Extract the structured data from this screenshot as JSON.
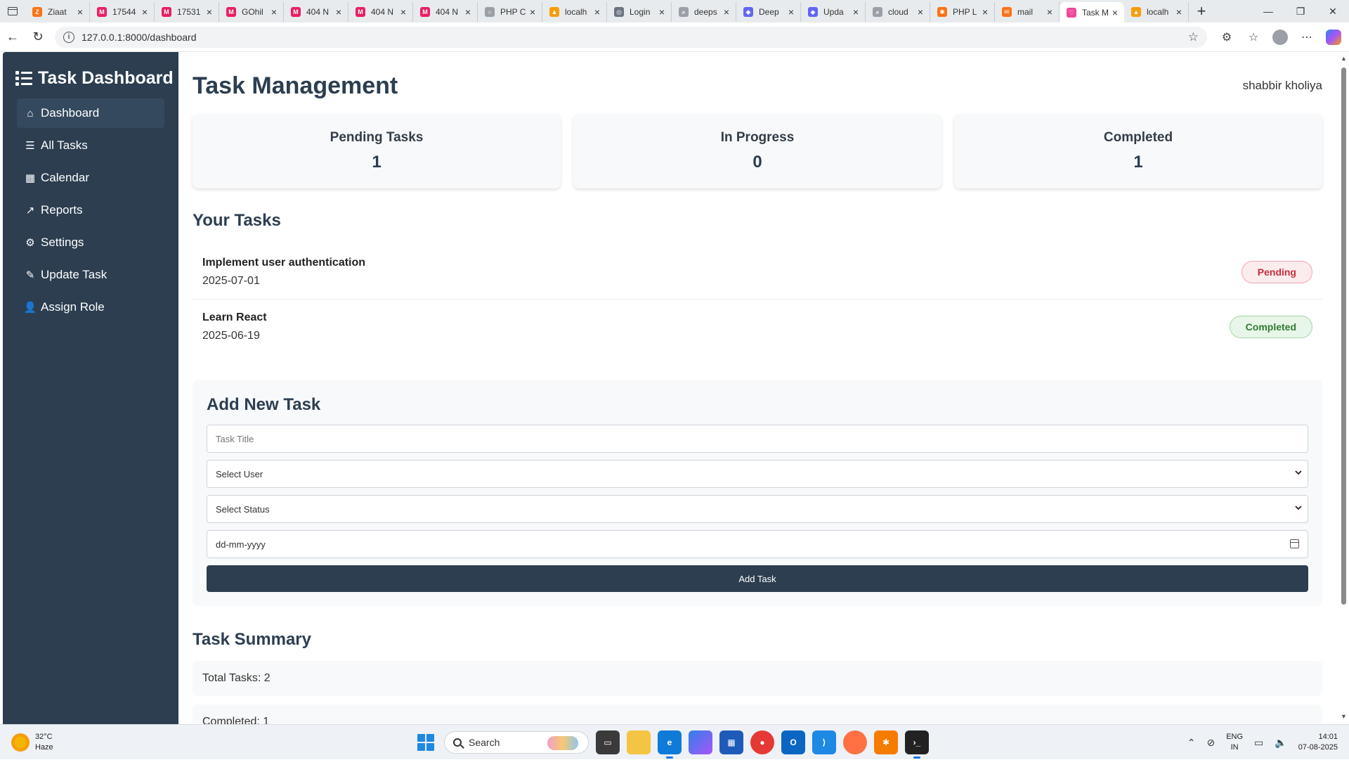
{
  "browser": {
    "tabs": [
      {
        "title": "Ziaat",
        "color": "#f97316",
        "glyph": "Z"
      },
      {
        "title": "17544",
        "color": "#e91e63",
        "glyph": "M"
      },
      {
        "title": "17531",
        "color": "#e91e63",
        "glyph": "M"
      },
      {
        "title": "GOhil",
        "color": "#e91e63",
        "glyph": "M"
      },
      {
        "title": "404 N",
        "color": "#e91e63",
        "glyph": "M"
      },
      {
        "title": "404 N",
        "color": "#e91e63",
        "glyph": "M"
      },
      {
        "title": "404 N",
        "color": "#e91e63",
        "glyph": "M"
      },
      {
        "title": "PHP C",
        "color": "#9aa0a6",
        "glyph": "○"
      },
      {
        "title": "localh",
        "color": "#f59e0b",
        "glyph": "▲"
      },
      {
        "title": "Login",
        "color": "#6b7280",
        "glyph": "◎"
      },
      {
        "title": "deeps",
        "color": "#9aa0a6",
        "glyph": "⌕"
      },
      {
        "title": "Deep",
        "color": "#6366f1",
        "glyph": "◆"
      },
      {
        "title": "Upda",
        "color": "#6366f1",
        "glyph": "◆"
      },
      {
        "title": "cloud",
        "color": "#9aa0a6",
        "glyph": "⌕"
      },
      {
        "title": "PHP L",
        "color": "#f97316",
        "glyph": "✱"
      },
      {
        "title": "mail",
        "color": "#f97316",
        "glyph": "✉"
      },
      {
        "title": "Task M",
        "color": "#ec4899",
        "glyph": "♡",
        "active": true
      },
      {
        "title": "localh",
        "color": "#f59e0b",
        "glyph": "▲"
      }
    ],
    "url": "127.0.0.1:8000/dashboard"
  },
  "sidebar": {
    "brand": "Task Dashboard",
    "items": [
      {
        "label": "Dashboard",
        "icon": "home-icon",
        "glyph": "⌂",
        "active": true
      },
      {
        "label": "All Tasks",
        "icon": "list-icon",
        "glyph": "☰"
      },
      {
        "label": "Calendar",
        "icon": "calendar-icon",
        "glyph": "▦"
      },
      {
        "label": "Reports",
        "icon": "chart-line-icon",
        "glyph": "↗"
      },
      {
        "label": "Settings",
        "icon": "gear-icon",
        "glyph": "⚙"
      },
      {
        "label": "Update Task",
        "icon": "edit-icon",
        "glyph": "✎"
      },
      {
        "label": "Assign Role",
        "icon": "user-cog-icon",
        "glyph": "👤"
      }
    ]
  },
  "header": {
    "title": "Task Management",
    "user": "shabbir kholiya"
  },
  "stats": [
    {
      "label": "Pending Tasks",
      "value": "1"
    },
    {
      "label": "In Progress",
      "value": "0"
    },
    {
      "label": "Completed",
      "value": "1"
    }
  ],
  "tasks": {
    "title": "Your Tasks",
    "items": [
      {
        "name": "Implement user authentication",
        "date": "2025-07-01",
        "status": "Pending",
        "status_key": "pending"
      },
      {
        "name": "Learn React",
        "date": "2025-06-19",
        "status": "Completed",
        "status_key": "completed"
      }
    ]
  },
  "add_task": {
    "title": "Add New Task",
    "title_placeholder": "Task Title",
    "user_select": "Select User",
    "status_select": "Select Status",
    "date_placeholder": "dd-mm-yyyy",
    "button": "Add Task"
  },
  "summary": {
    "title": "Task Summary",
    "rows": [
      "Total Tasks: 2",
      "Completed: 1"
    ]
  },
  "taskbar": {
    "temp": "32°C",
    "weather": "Haze",
    "search": "Search",
    "lang1": "ENG",
    "lang2": "IN",
    "time": "14:01",
    "date": "07-08-2025"
  },
  "colors": {
    "sidebar_bg": "#2c3e50",
    "sidebar_active": "#34495e",
    "primary": "#2c3e50",
    "pending": "#c62d3a",
    "completed": "#2e7d32"
  }
}
